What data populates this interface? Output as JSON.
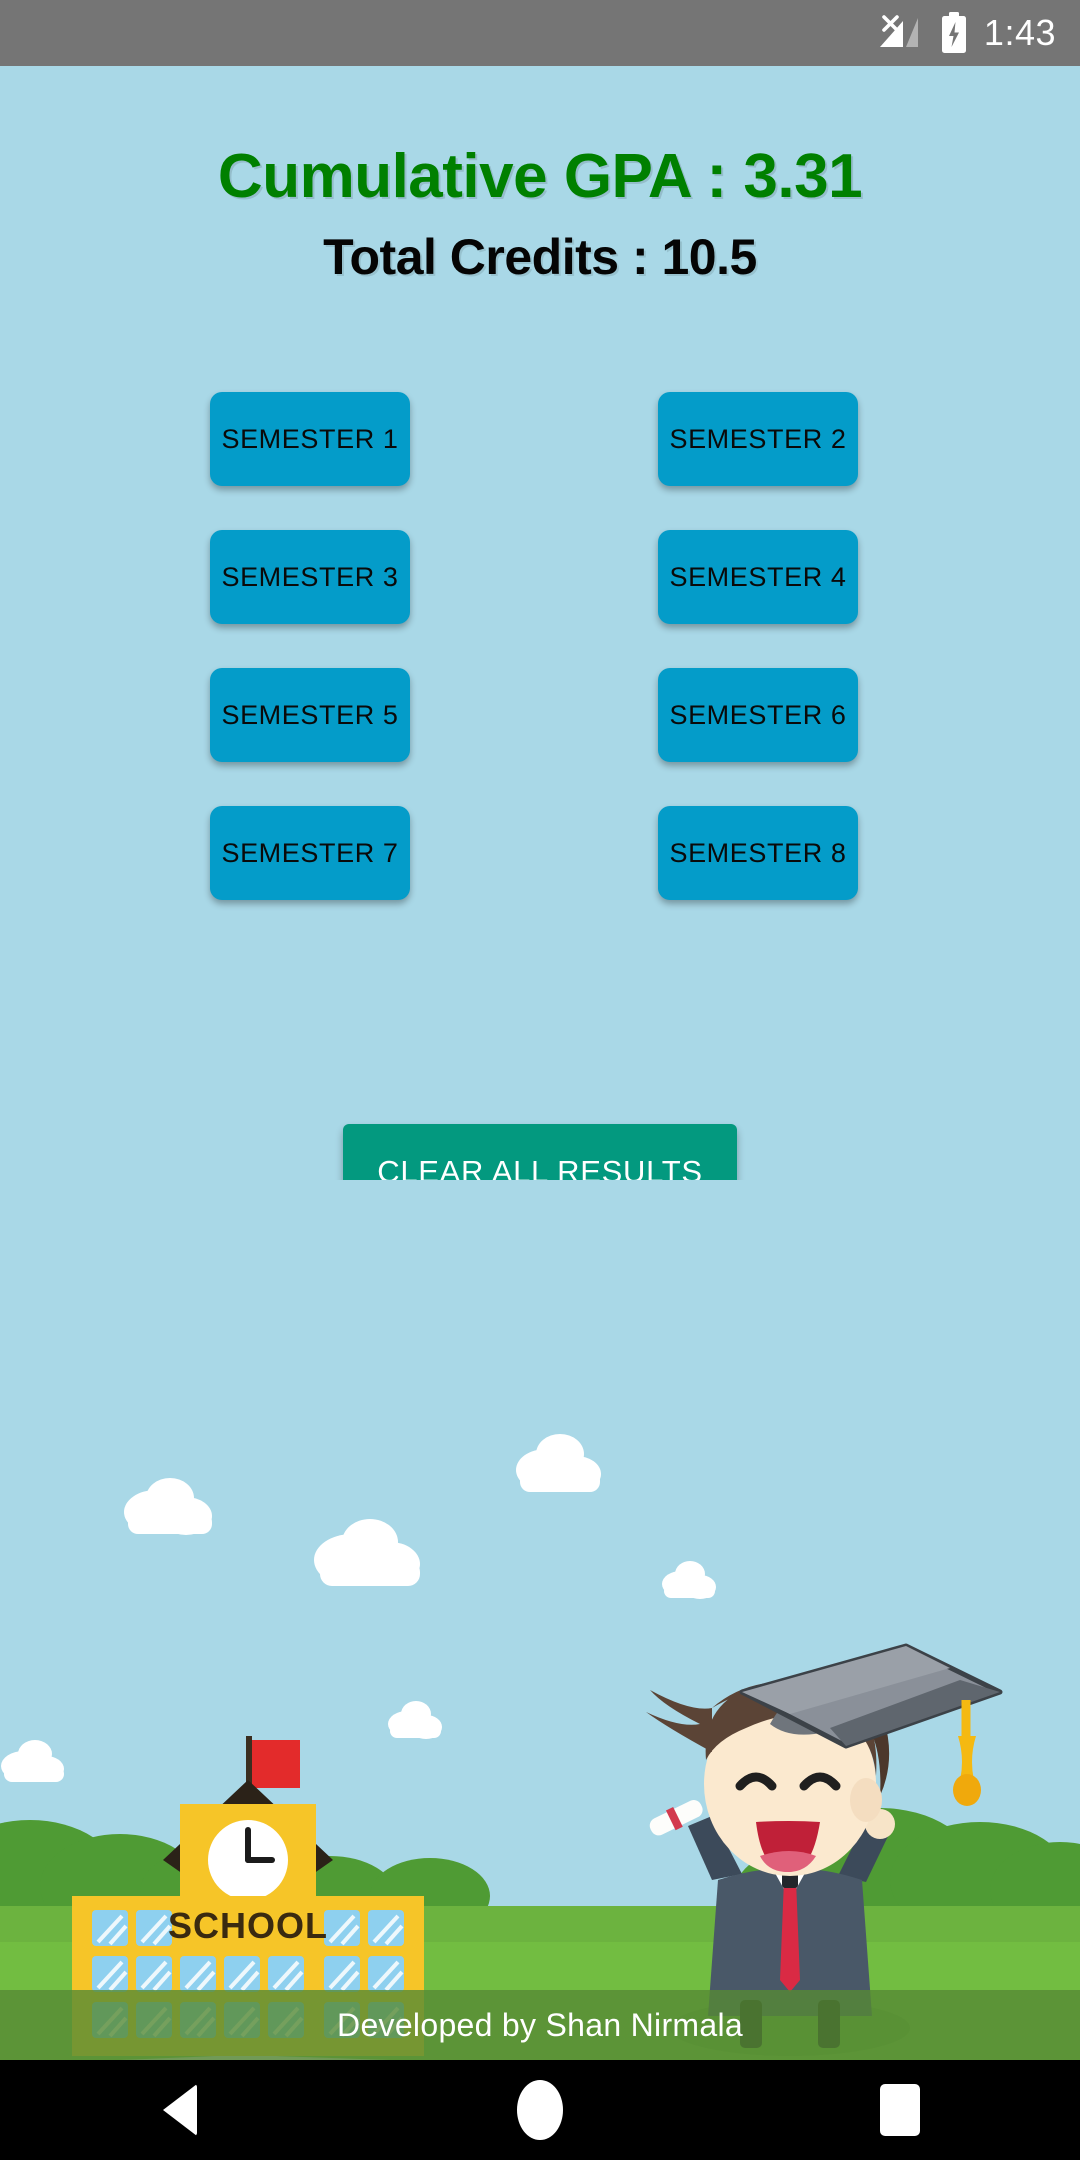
{
  "status_bar": {
    "time": "1:43",
    "signal_icon": "signal-no-sim-icon",
    "battery_icon": "battery-charging-icon",
    "background_color": "#757575"
  },
  "header": {
    "gpa_label": "Cumulative GPA : 3.31",
    "gpa_value": "3.31",
    "gpa_color": "#008000",
    "credits_label": "Total Credits : 10.5",
    "credits_value": "10.5",
    "credits_color": "#050505"
  },
  "semesters": [
    {
      "label": "SEMESTER 1"
    },
    {
      "label": "SEMESTER 2"
    },
    {
      "label": "SEMESTER 3"
    },
    {
      "label": "SEMESTER 4"
    },
    {
      "label": "SEMESTER 5"
    },
    {
      "label": "SEMESTER 6"
    },
    {
      "label": "SEMESTER 7"
    },
    {
      "label": "SEMESTER 8"
    }
  ],
  "actions": {
    "clear_all_label": "CLEAR ALL RESULTS",
    "clear_all_color": "#03997f",
    "semester_button_color": "#049cc9"
  },
  "illustration": {
    "school_sign_text": "SCHOOL",
    "sky_color": "#a9d8e7",
    "grass_color": "#6cb33f",
    "building_color": "#f6c528",
    "flag_color": "#e32b2b",
    "cap_color": "#666b72",
    "tassel_color": "#f5b911"
  },
  "footer": {
    "credit_text": "Developed by Shan Nirmala"
  },
  "navigation": {
    "back_label": "Back",
    "home_label": "Home",
    "recents_label": "Recents"
  }
}
